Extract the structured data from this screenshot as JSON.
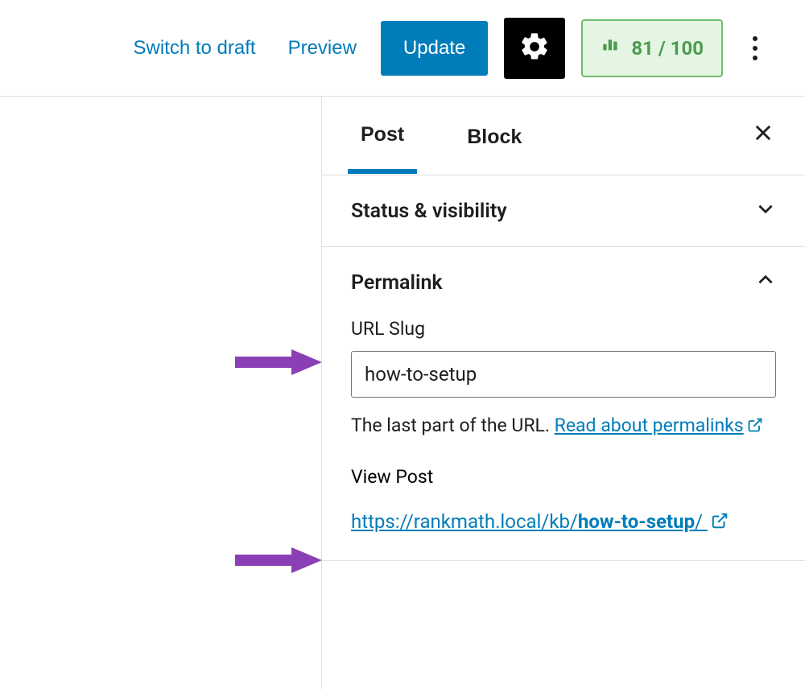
{
  "toolbar": {
    "switch_to_draft": "Switch to draft",
    "preview": "Preview",
    "update": "Update",
    "score": "81 / 100"
  },
  "tabs": {
    "post": "Post",
    "block": "Block"
  },
  "panels": {
    "status_visibility": {
      "title": "Status & visibility"
    },
    "permalink": {
      "title": "Permalink",
      "url_slug_label": "URL Slug",
      "url_slug_value": "how-to-setup",
      "help_prefix": "The last part of the URL. ",
      "help_link": "Read about permalinks",
      "view_post_label": "View Post",
      "url_base": "https://rankmath.local/kb/",
      "url_slug_bold": "how-to-setup",
      "url_trail": "/"
    }
  }
}
